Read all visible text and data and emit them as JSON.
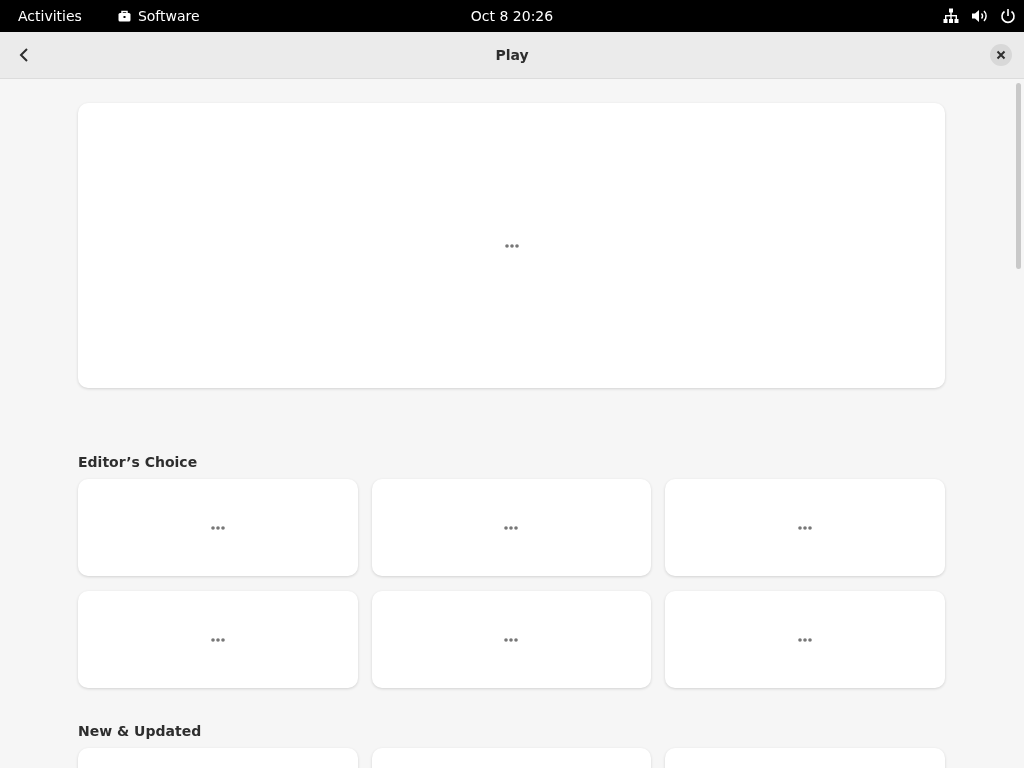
{
  "top_bar": {
    "activities": "Activities",
    "app_name": "Software",
    "clock": "Oct 8  20:26"
  },
  "header": {
    "title": "Play"
  },
  "featured": {
    "loading": true
  },
  "sections": [
    {
      "title": "Editor’s Choice",
      "cards": [
        {
          "loading": true
        },
        {
          "loading": true
        },
        {
          "loading": true
        },
        {
          "loading": true
        },
        {
          "loading": true
        },
        {
          "loading": true
        }
      ]
    },
    {
      "title": "New & Updated"
    }
  ]
}
